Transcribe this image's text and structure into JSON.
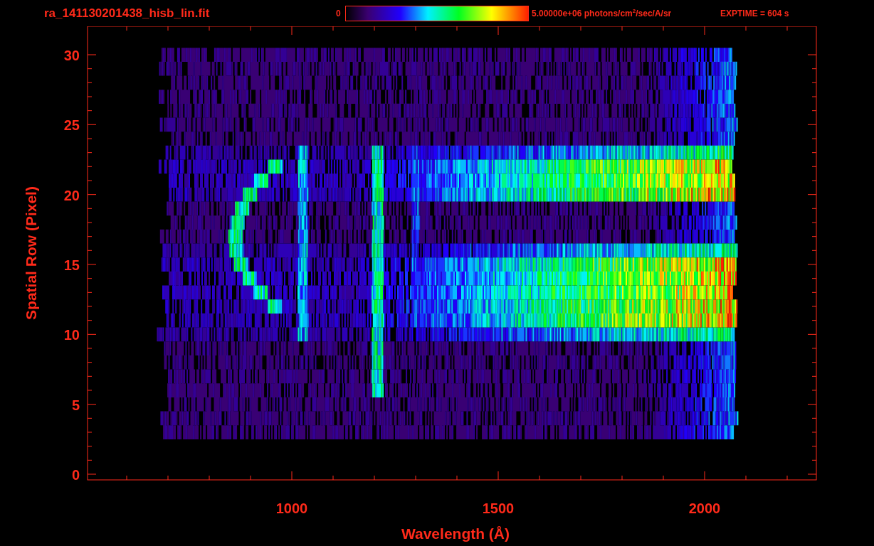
{
  "header": {
    "file_name": "ra_141130201438_hisb_lin.fit",
    "colorbar_min": "0",
    "colorbar_max": "5.00000e+06 photons/cm$^{2}$/sec/A/sr",
    "exposure": "EXPTIME = 604 s"
  },
  "plot": {
    "ylabel": "Spatial Row (Pixel)",
    "xlabel": "Wavelength (Å)",
    "xticks": [
      "1000",
      "1500",
      "2000"
    ],
    "yticks": [
      "30",
      "25",
      "20",
      "15",
      "10",
      "5",
      "0"
    ]
  }
}
